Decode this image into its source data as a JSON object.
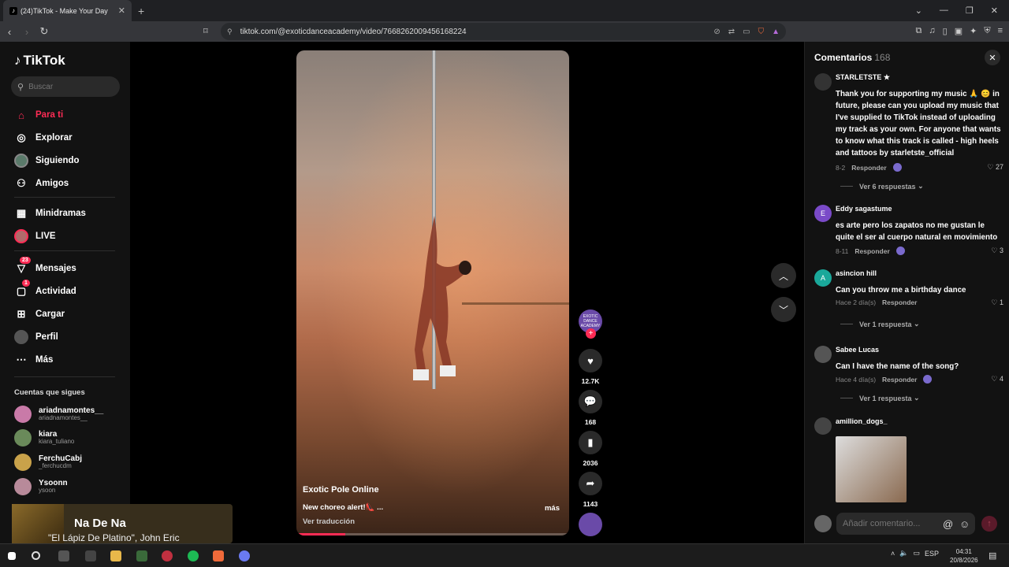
{
  "browser": {
    "tab_title": "(24)TikTok - Make Your Day",
    "url": "tiktok.com/@exoticdanceacademy/video/7668262009456168224"
  },
  "sidebar": {
    "logo": "TikTok",
    "search_placeholder": "Buscar",
    "items": [
      {
        "label": "Para ti",
        "icon": "home-icon"
      },
      {
        "label": "Explorar",
        "icon": "compass-icon"
      },
      {
        "label": "Siguiendo",
        "icon": "avatar-icon"
      },
      {
        "label": "Amigos",
        "icon": "friends-icon"
      },
      {
        "label": "Minidramas",
        "icon": "film-icon"
      },
      {
        "label": "LIVE",
        "icon": "live-icon"
      },
      {
        "label": "Mensajes",
        "icon": "messages-icon",
        "badge": "23"
      },
      {
        "label": "Actividad",
        "icon": "activity-icon",
        "badge": "1"
      },
      {
        "label": "Cargar",
        "icon": "upload-icon"
      },
      {
        "label": "Perfil",
        "icon": "profile-icon"
      },
      {
        "label": "Más",
        "icon": "more-icon"
      }
    ],
    "following_title": "Cuentas que sigues",
    "following": [
      {
        "name": "ariadnamontes__",
        "handle": "ariadnamontes__"
      },
      {
        "name": "kiara",
        "handle": "kiara_tuliano"
      },
      {
        "name": "FerchuCabj",
        "handle": "_ferchucdm"
      },
      {
        "name": "Ysoonn",
        "handle": "ysoon"
      }
    ]
  },
  "music_widget": {
    "title": "Na De Na",
    "subtitle": "\"El Lápiz De Platino\", John Eric"
  },
  "video": {
    "username": "Exotic Pole Online",
    "caption": "New choreo alert!👠 ...",
    "more": "más",
    "translate": "Ver traducción",
    "progress": 0.18
  },
  "actions": {
    "avatar_text": "EXOTIC DANCE ACADEMY",
    "likes": "12.7K",
    "comments": "168",
    "saves": "2036",
    "shares": "1143"
  },
  "comments_panel": {
    "title": "Comentarios",
    "count": "168",
    "input_placeholder": "Añadir comentario...",
    "reply_label": "Responder",
    "items": [
      {
        "user": "STARLETSTE ★",
        "text": "Thank you for supporting my music 🙏 😊 in future, please can you upload my music that I've supplied to TikTok instead of uploading my track as your own. For anyone that wants to know what this track is called - high heels and tattoos by starletste_official",
        "date": "8-2",
        "likes": "27",
        "replies": "Ver 6 respuestas"
      },
      {
        "user": "Eddy sagastume",
        "text": "es arte pero los zapatos no me gustan le quite el ser al cuerpo natural en movimiento",
        "date": "8-11",
        "likes": "3",
        "replies": ""
      },
      {
        "user": "asincion hill",
        "text": "Can you throw me a birthday dance",
        "date": "Hace 2 día(s)",
        "likes": "1",
        "replies": "Ver 1 respuesta"
      },
      {
        "user": "Sabee Lucas",
        "text": "Can I have the name of the song?",
        "date": "Hace 4 día(s)",
        "likes": "4",
        "replies": "Ver 1 respuesta"
      },
      {
        "user": "amillion_dogs_",
        "text": "",
        "date": "",
        "likes": "",
        "replies": ""
      }
    ]
  },
  "taskbar": {
    "lang": "ESP",
    "time": "04:31",
    "date": "20/8/2026"
  },
  "colors": {
    "accent": "#fe2c55",
    "background": "#121212"
  }
}
